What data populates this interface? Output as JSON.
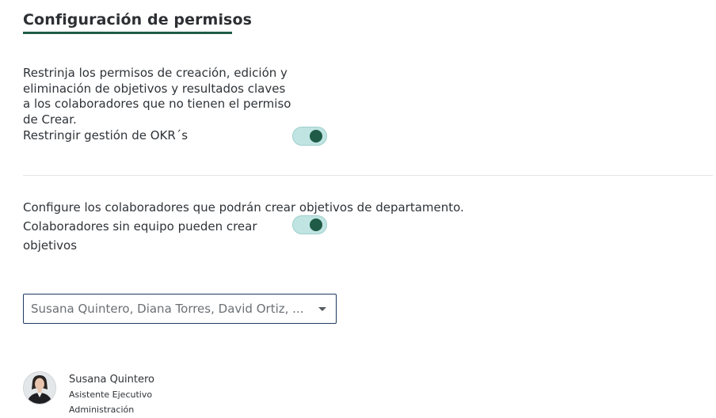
{
  "header": {
    "title": "Configuración de permisos"
  },
  "okr_section": {
    "description": "Restrinja los permisos de creación, edición y eliminación de objetivos y resultados claves a los colaboradores que no tienen el permiso de Crear.",
    "toggle_label": "Restringir gestión de OKR´s",
    "toggle_on": true
  },
  "department_section": {
    "description": "Configure los colaboradores que podrán crear objetivos de departamento.",
    "toggle_label": "Colaboradores sin equipo pueden crear objetivos",
    "toggle_on": true,
    "select_value": "Susana Quintero, Diana Torres, David Ortiz, ..."
  },
  "user": {
    "name": "Susana Quintero",
    "role": "Asistente Ejecutivo",
    "department": "Administración",
    "avatar_icon": "user-photo-icon"
  },
  "colors": {
    "accent": "#1f5b46",
    "toggle_track": "#bfe4e2",
    "divider": "#e3e5e7",
    "select_border": "#1e3a5f"
  }
}
